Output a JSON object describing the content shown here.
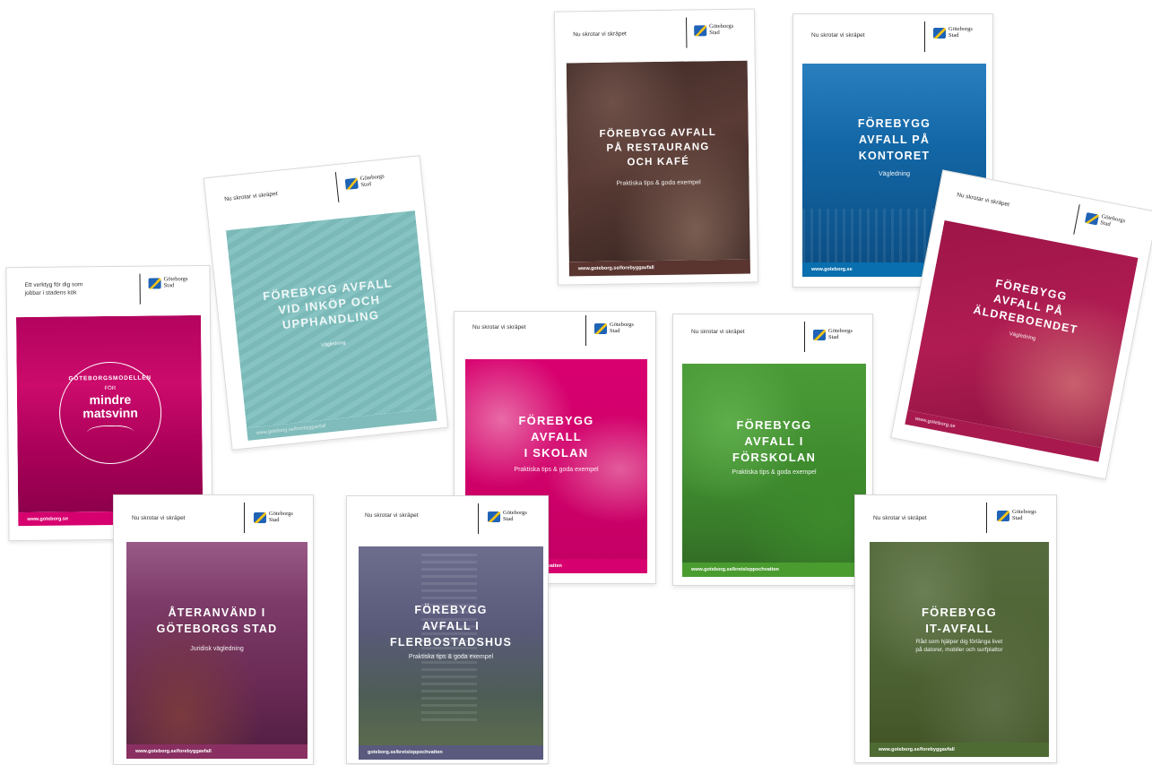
{
  "brochures": {
    "matsvinn": {
      "tagline": "Ett verktyg för dig som\njobbar i stadens kök",
      "logo": "Göteborgs\nStad",
      "badge_top": "GÖTEBORGSMODELLEN",
      "badge_for": "FÖR",
      "badge_main": "mindre\nmatsvinn",
      "footer": "www.goteborg.se",
      "color": "#d6006f"
    },
    "inkop": {
      "tagline": "Nu skrotar vi skräpet",
      "logo": "Göteborgs\nStad",
      "title": "FÖREBYGG AVFALL\nVID INKÖP OCH\nUPPHANDLING",
      "subtitle": "Vägledning",
      "footer": "www.goteborg.se/forebyggavfall",
      "color": "#7fbcbb"
    },
    "restaurang": {
      "tagline": "Nu skrotar vi skräpet",
      "logo": "Göteborgs\nStad",
      "title": "FÖREBYGG AVFALL\nPÅ RESTAURANG\nOCH KAFÉ",
      "subtitle": "Praktiska tips & goda exempel",
      "footer": "www.goteborg.se/forebyggavfall",
      "color": "#5a3530"
    },
    "kontoret": {
      "tagline": "Nu skrotar vi skräpet",
      "logo": "Göteborgs\nStad",
      "title": "FÖREBYGG\nAVFALL PÅ\nKONTORET",
      "subtitle": "Vägledning",
      "footer": "www.goteborg.se",
      "color": "#0a6fae"
    },
    "aldreboende": {
      "tagline": "Nu skrotar vi skräpet",
      "logo": "Göteborgs\nStad",
      "title": "FÖREBYGG\nAVFALL PÅ\nÄLDREBOENDET",
      "subtitle": "Vägledning",
      "footer": "www.goteborg.se",
      "color": "#a8194d"
    },
    "skolan": {
      "tagline": "Nu skrotar vi skräpet",
      "logo": "Göteborgs\nStad",
      "title": "FÖREBYGG\nAVFALL\nI SKOLAN",
      "subtitle": "Praktiska tips & goda exempel",
      "footer": "www.goteborg.se/kretsloppochvatten",
      "color": "#d6006f"
    },
    "forskolan": {
      "tagline": "Nu skrotar vi skräpet",
      "logo": "Göteborgs\nStad",
      "title": "FÖREBYGG\nAVFALL I\nFÖRSKOLAN",
      "subtitle": "Praktiska tips & goda exempel",
      "footer": "www.goteborg.se/kretsloppochvatten",
      "color": "#4a9c2f"
    },
    "ateranvand": {
      "tagline": "Nu skrotar vi skräpet",
      "logo": "Göteborgs\nStad",
      "title": "ÅTERANVÄND I\nGÖTEBORGS STAD",
      "subtitle": "Juridisk vägledning",
      "footer": "www.goteborg.se/forebyggavfall",
      "color": "#8a2f62"
    },
    "flerbostad": {
      "tagline": "Nu skrotar vi skräpet",
      "logo": "Göteborgs\nStad",
      "title": "FÖREBYGG\nAVFALL I\nFLERBOSTADSHUS",
      "subtitle": "Praktiska tips & goda exempel",
      "footer": "goteborg.se/kretsloppochvatten",
      "color": "#5a5a7e"
    },
    "itavfall": {
      "tagline": "Nu skrotar vi skräpet",
      "logo": "Göteborgs\nStad",
      "title": "FÖREBYGG\nIT-AVFALL",
      "subtitle": "Råd som hjälper dig förlänga livet\npå datorer, mobiler och surfplattor",
      "footer": "www.goteborg.se/forebyggavfall",
      "color": "#4e6b33"
    }
  }
}
